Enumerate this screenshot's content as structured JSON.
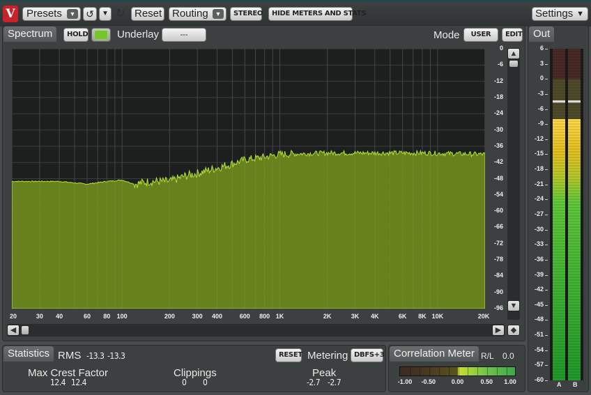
{
  "toolbar": {
    "logo": "V",
    "presets_label": "Presets",
    "reset_label": "Reset",
    "routing_label": "Routing",
    "stereo_label": "STEREO",
    "hide_meters_label": "HIDE METERS AND STATS",
    "settings_label": "Settings"
  },
  "spectrum": {
    "tab_label": "Spectrum",
    "hold_label": "HOLD",
    "underlay_label": "Underlay",
    "underlay_value": "---",
    "mode_label": "Mode",
    "mode_value": "USER",
    "edit_label": "EDIT",
    "fill_color": "#6e8a1c",
    "line_color": "#b7e23a",
    "db_ticks": [
      "0",
      "-6",
      "-12",
      "-18",
      "-24",
      "-30",
      "-36",
      "-42",
      "-48",
      "-54",
      "-60",
      "-66",
      "-72",
      "-78",
      "-84",
      "-90",
      "-96"
    ],
    "freq_ticks": [
      "20",
      "30",
      "40",
      "60",
      "80",
      "100",
      "200",
      "300",
      "400",
      "600",
      "800",
      "1K",
      "2K",
      "3K",
      "4K",
      "6K",
      "8K",
      "10K",
      "20K"
    ]
  },
  "chart_data": {
    "type": "area",
    "xlabel": "",
    "ylabel": "",
    "x_scale": "log",
    "xlim": [
      20,
      20000
    ],
    "ylim": [
      -96,
      0
    ],
    "x": [
      20,
      40,
      60,
      80,
      100,
      120,
      150,
      200,
      250,
      300,
      400,
      500,
      600,
      800,
      1000,
      2000,
      4000,
      8000,
      20000
    ],
    "y": [
      -49,
      -49,
      -50,
      -49,
      -48.5,
      -50,
      -49,
      -49,
      -47,
      -46,
      -44,
      -42.5,
      -41,
      -40,
      -39,
      -38.5,
      -38.5,
      -38.5,
      -39
    ]
  },
  "out_meter": {
    "tab_label": "Out",
    "db_ticks": [
      "6",
      "3",
      "0",
      "-3",
      "-6",
      "-9",
      "-12",
      "-15",
      "-18",
      "-21",
      "-24",
      "-27",
      "-30",
      "-33",
      "-36",
      "-39",
      "-42",
      "-45",
      "-48",
      "-51",
      "-54",
      "-57",
      "-60"
    ],
    "channels": [
      "A",
      "B"
    ],
    "level_db": -8,
    "peak_hold_db": -4.5
  },
  "statistics": {
    "tab_label": "Statistics",
    "rms_label": "RMS",
    "rms_a": "-13.3",
    "rms_b": "-13.3",
    "reset_label": "RESET",
    "metering_label": "Metering",
    "metering_value": "DBFS+3",
    "crest_label": "Max Crest Factor",
    "crest_a": "12.4",
    "crest_b": "12.4",
    "clippings_label": "Clippings",
    "clip_a": "0",
    "clip_b": "0",
    "peak_label": "Peak",
    "peak_a": "-2.7",
    "peak_b": "-2.7"
  },
  "correlation": {
    "tab_label": "Correlation Meter",
    "rl_label": "R/L",
    "rl_value": "0.0",
    "scale": [
      "-1.00",
      "-0.50",
      "0.00",
      "0.50",
      "1.00"
    ],
    "value": 0.0
  }
}
